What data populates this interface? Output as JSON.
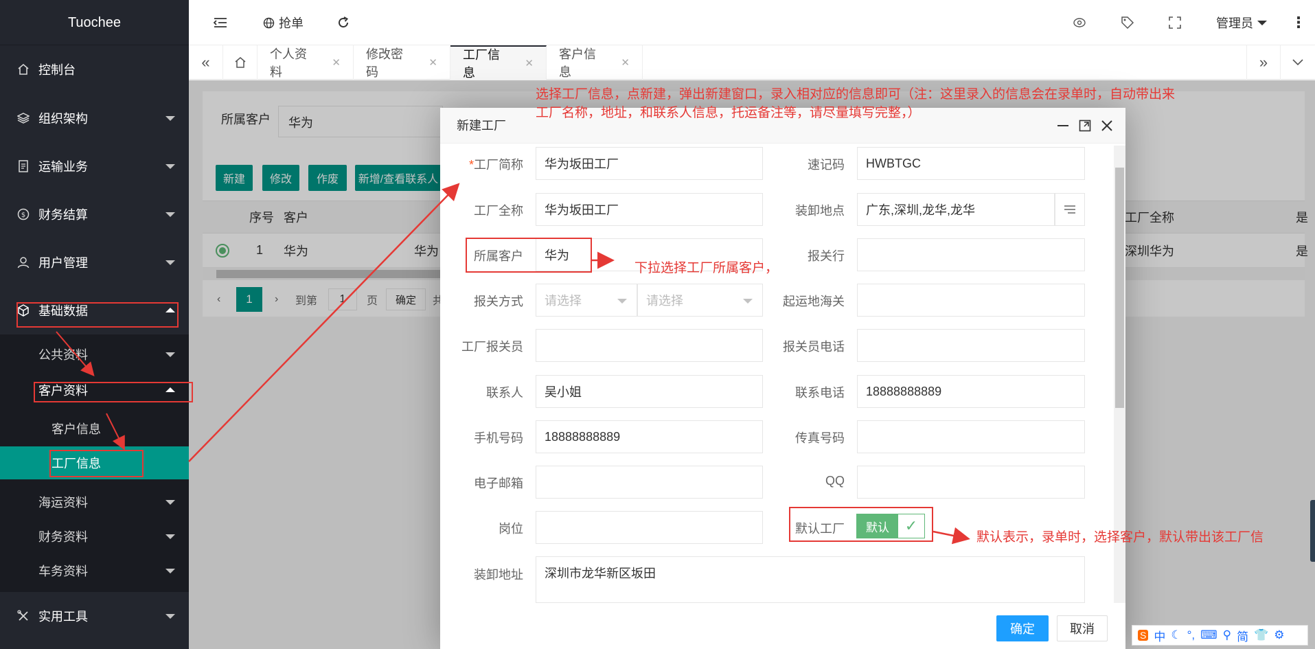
{
  "app": {
    "title": "Tuochee"
  },
  "sidebar": {
    "items": [
      {
        "label": "控制台"
      },
      {
        "label": "组织架构"
      },
      {
        "label": "运输业务"
      },
      {
        "label": "财务结算"
      },
      {
        "label": "用户管理"
      },
      {
        "label": "基础数据"
      },
      {
        "label": "实用工具"
      }
    ],
    "sub": [
      {
        "label": "公共资料"
      },
      {
        "label": "客户资料"
      },
      {
        "label": "海运资料"
      },
      {
        "label": "财务资料"
      },
      {
        "label": "车务资料"
      }
    ],
    "sub2": [
      {
        "label": "客户信息"
      },
      {
        "label": "工厂信息"
      }
    ]
  },
  "header": {
    "grab_label": "抢单",
    "user_label": "管理员"
  },
  "tabs": [
    {
      "label": "个人资料"
    },
    {
      "label": "修改密码"
    },
    {
      "label": "工厂信息"
    },
    {
      "label": "客户信息"
    }
  ],
  "main": {
    "filter_label": "所属客户",
    "filter_value": "华为",
    "buttons": [
      "新建",
      "修改",
      "作废",
      "新增/查看联系人"
    ],
    "columns": {
      "seq": "序号",
      "customer": "客户",
      "factory_full": "工厂全称",
      "is": "是"
    },
    "row": {
      "seq": "1",
      "customer": "华为",
      "short": "华为",
      "factory_full": "深圳华为",
      "is": "是"
    },
    "pager": {
      "page": "1",
      "goto": "到第",
      "input": "1",
      "page_unit": "页",
      "confirm": "确定",
      "total": "共"
    }
  },
  "modal": {
    "title": "新建工厂",
    "fields": {
      "short_name": {
        "label": "工厂简称",
        "value": "华为坂田工厂"
      },
      "quick_code": {
        "label": "速记码",
        "value": "HWBTGC"
      },
      "full_name": {
        "label": "工厂全称",
        "value": "华为坂田工厂"
      },
      "load_place": {
        "label": "装卸地点",
        "value": "广东,深圳,龙华,龙华"
      },
      "customer": {
        "label": "所属客户",
        "value": "华为"
      },
      "customs_broker": {
        "label": "报关行",
        "value": ""
      },
      "declare_mode": {
        "label": "报关方式",
        "placeholder1": "请选择",
        "placeholder2": "请选择"
      },
      "origin_customs": {
        "label": "起运地海关",
        "value": ""
      },
      "factory_declarant": {
        "label": "工厂报关员",
        "value": ""
      },
      "declarant_phone": {
        "label": "报关员电话",
        "value": ""
      },
      "contact": {
        "label": "联系人",
        "value": "吴小姐"
      },
      "contact_phone": {
        "label": "联系电话",
        "value": "18888888889"
      },
      "mobile": {
        "label": "手机号码",
        "value": "18888888889"
      },
      "fax": {
        "label": "传真号码",
        "value": ""
      },
      "email": {
        "label": "电子邮箱",
        "value": ""
      },
      "qq": {
        "label": "QQ",
        "value": ""
      },
      "position": {
        "label": "岗位",
        "value": ""
      },
      "default_factory": {
        "label": "默认工厂",
        "switch_text": "默认"
      },
      "address": {
        "label": "装卸地址",
        "value": "深圳市龙华新区坂田"
      }
    },
    "ok_label": "确定",
    "cancel_label": "取消"
  },
  "annotations": {
    "top_line1": "选择工厂信息，点新建，弹出新建窗口，录入相对应的信息即可（注：这里录入的信息会在录单时，自动带出来",
    "top_line2": "工厂名称，地址，和联系人信息，托运备注等，请尽量填写完整，）",
    "customer_note": "下拉选择工厂所属客户，",
    "default_note": "默认表示，录单时，选择客户，默认带出该工厂信"
  },
  "ime": {
    "zh": "中",
    "simplified": "简"
  },
  "colors": {
    "sidebar": "#23262e",
    "accent": "#009688",
    "annotation": "#e53935",
    "switch": "#5fb878"
  }
}
